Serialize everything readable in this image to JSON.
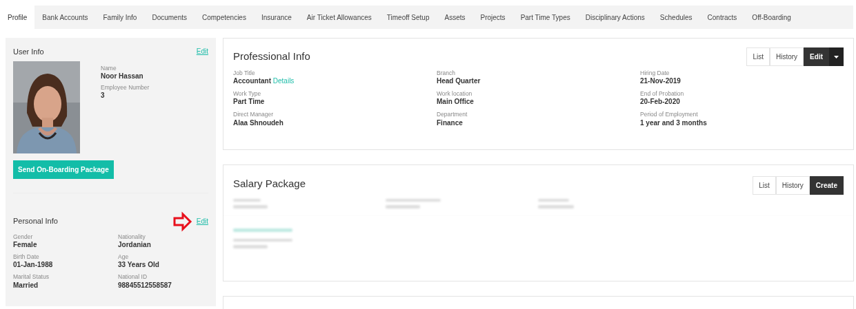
{
  "tabs": [
    {
      "label": "Profile",
      "selected": true
    },
    {
      "label": "Bank Accounts",
      "selected": false
    },
    {
      "label": "Family Info",
      "selected": false
    },
    {
      "label": "Documents",
      "selected": false
    },
    {
      "label": "Competencies",
      "selected": false
    },
    {
      "label": "Insurance",
      "selected": false
    },
    {
      "label": "Air Ticket Allowances",
      "selected": false
    },
    {
      "label": "Timeoff Setup",
      "selected": false
    },
    {
      "label": "Assets",
      "selected": false
    },
    {
      "label": "Projects",
      "selected": false
    },
    {
      "label": "Part Time Types",
      "selected": false
    },
    {
      "label": "Disciplinary Actions",
      "selected": false
    },
    {
      "label": "Schedules",
      "selected": false
    },
    {
      "label": "Contracts",
      "selected": false
    },
    {
      "label": "Off-Boarding",
      "selected": false
    }
  ],
  "user_info": {
    "title": "User Info",
    "edit_link": "Edit",
    "fields": [
      {
        "label": "Name",
        "value": "Noor Hassan"
      },
      {
        "label": "Employee Number",
        "value": "3"
      }
    ],
    "button": "Send On-Boarding Package"
  },
  "personal_info": {
    "title": "Personal Info",
    "edit_link": "Edit",
    "fields": [
      {
        "label": "Gender",
        "value": "Female"
      },
      {
        "label": "Nationality",
        "value": "Jordanian"
      },
      {
        "label": "Birth Date",
        "value": "01-Jan-1988"
      },
      {
        "label": "Age",
        "value": "33 Years Old"
      },
      {
        "label": "Marital Status",
        "value": "Married"
      },
      {
        "label": "National ID",
        "value": "98845512558587"
      }
    ]
  },
  "professional_info": {
    "title": "Professional Info",
    "buttons": [
      {
        "label": "List",
        "kind": "light"
      },
      {
        "label": "History",
        "kind": "light"
      },
      {
        "label": "Edit",
        "kind": "dark"
      },
      {
        "kind": "caret"
      }
    ],
    "columns": [
      [
        {
          "label": "Job Title",
          "value": "Accountant",
          "link": "Details"
        },
        {
          "label": "Work Type",
          "value": "Part Time"
        },
        {
          "label": "Direct Manager",
          "value": "Alaa Shnoudeh"
        }
      ],
      [
        {
          "label": "Branch",
          "value": "Head Quarter"
        },
        {
          "label": "Work location",
          "value": "Main Office"
        },
        {
          "label": "Department",
          "value": "Finance"
        }
      ],
      [
        {
          "label": "Hiring Date",
          "value": "21-Nov-2019"
        },
        {
          "label": "End of Probation",
          "value": "20-Feb-2020"
        },
        {
          "label": "Period of Employment",
          "value": "1 year and 3 months"
        }
      ]
    ]
  },
  "salary_package": {
    "title": "Salary Package",
    "buttons": [
      {
        "label": "List",
        "kind": "light"
      },
      {
        "label": "History",
        "kind": "light"
      },
      {
        "label": "Create",
        "kind": "dark"
      }
    ]
  }
}
